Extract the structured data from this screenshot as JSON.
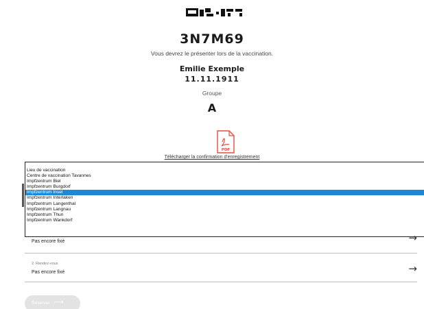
{
  "header": {
    "appointment_code": "3N7M69",
    "hint": "Vous devrez le présenter lors de la vaccination.",
    "name": "Emilie Exemple",
    "dob": "11.11.1911",
    "group_label": "Groupe",
    "group_value": "A"
  },
  "pdf": {
    "icon": "pdf-file-icon",
    "icon_text": "PDF",
    "link": "Télécharger la confirmation d'enregistrement"
  },
  "dropdown": {
    "options": [
      "Lieu de vaccination",
      "Centre de vaccination Tavannes",
      "Impfzentrum Biel",
      "Impfzentrum Burgdorf",
      "Impfzentrum Insel",
      "Impfzentrum Interlaken",
      "Impfzentrum Langenthal",
      "Impfzentrum Langnau",
      "Impfzentrum Thun",
      "Impfzentrum Wankdorf"
    ],
    "selected": "Impfzentrum Insel"
  },
  "appointments": [
    {
      "label": "",
      "value": "Pas encore fixé"
    },
    {
      "label": "2. Rendez-vous",
      "value": "Pas encore fixé"
    }
  ],
  "reserve_button": {
    "label": "Réserver"
  },
  "colors": {
    "selection": "#1e88d6",
    "button_disabled": "#e3e3e3"
  }
}
